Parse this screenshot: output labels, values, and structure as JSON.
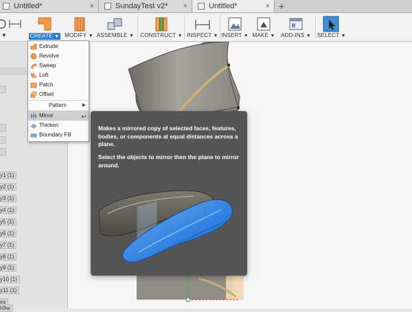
{
  "tabs": [
    {
      "label": "Untitled*",
      "close": "×",
      "active": false
    },
    {
      "label": "SundayTest v2*",
      "close": "×",
      "active": false
    },
    {
      "label": "Untitled*",
      "close": "×",
      "active": true
    }
  ],
  "tab_add": "+",
  "toolbar": {
    "groups": [
      {
        "id": "create",
        "label": "CREATE",
        "active": true,
        "caret": "▼"
      },
      {
        "id": "modify",
        "label": "MODIFY",
        "active": false,
        "caret": "▼"
      },
      {
        "id": "assemble",
        "label": "ASSEMBLE",
        "active": false,
        "caret": "▼"
      },
      {
        "id": "construct",
        "label": "CONSTRUCT",
        "active": false,
        "caret": "▼"
      },
      {
        "id": "inspect",
        "label": "INSPECT",
        "active": false,
        "caret": "▼"
      },
      {
        "id": "insert",
        "label": "INSERT",
        "active": false,
        "caret": "▼"
      },
      {
        "id": "make",
        "label": "MAKE",
        "active": false,
        "caret": "▼"
      },
      {
        "id": "addins",
        "label": "ADD-INS",
        "active": false,
        "caret": "▼"
      },
      {
        "id": "select",
        "label": "SELECT",
        "active": false,
        "caret": "▼"
      }
    ],
    "partial_left_caret": "▼"
  },
  "create_menu": {
    "items": [
      {
        "label": "Extrude",
        "icon": "extrude-icon"
      },
      {
        "label": "Revolve",
        "icon": "revolve-icon"
      },
      {
        "label": "Sweep",
        "icon": "sweep-icon"
      },
      {
        "label": "Loft",
        "icon": "loft-icon"
      },
      {
        "label": "Patch",
        "icon": "patch-icon"
      },
      {
        "label": "Offset",
        "icon": "offset-icon"
      },
      {
        "label": "Pattern",
        "icon": "",
        "submenu_arrow": "▶"
      },
      {
        "label": "Mirror",
        "icon": "mirror-icon",
        "highlighted": true,
        "shortcut_glyph": "↩"
      },
      {
        "label": "Thicken",
        "icon": "thicken-icon"
      },
      {
        "label": "Boundary Fill",
        "icon": "boundary-fill-icon"
      }
    ]
  },
  "tooltip": {
    "description": "Makes a mirrored copy of selected faces, features, bodies, or components at equal distances across a plane.",
    "instruction": "Select the objects to mirror then the plane to mirror around."
  },
  "browser": {
    "components": [
      "y1 (1)",
      "y2 (1)",
      "y3 (1)",
      "y4 (1)",
      "y5 (1)",
      "y6 (1)",
      "y7 (1)",
      "y8 (1)",
      "y9 (1)",
      "y10 (1)",
      "y11 (1)",
      "es",
      "h9w"
    ]
  },
  "colors": {
    "accent": "#2a7bd1",
    "tooltip_bg": "#555555",
    "mirror_blue": "#3a86e0"
  }
}
